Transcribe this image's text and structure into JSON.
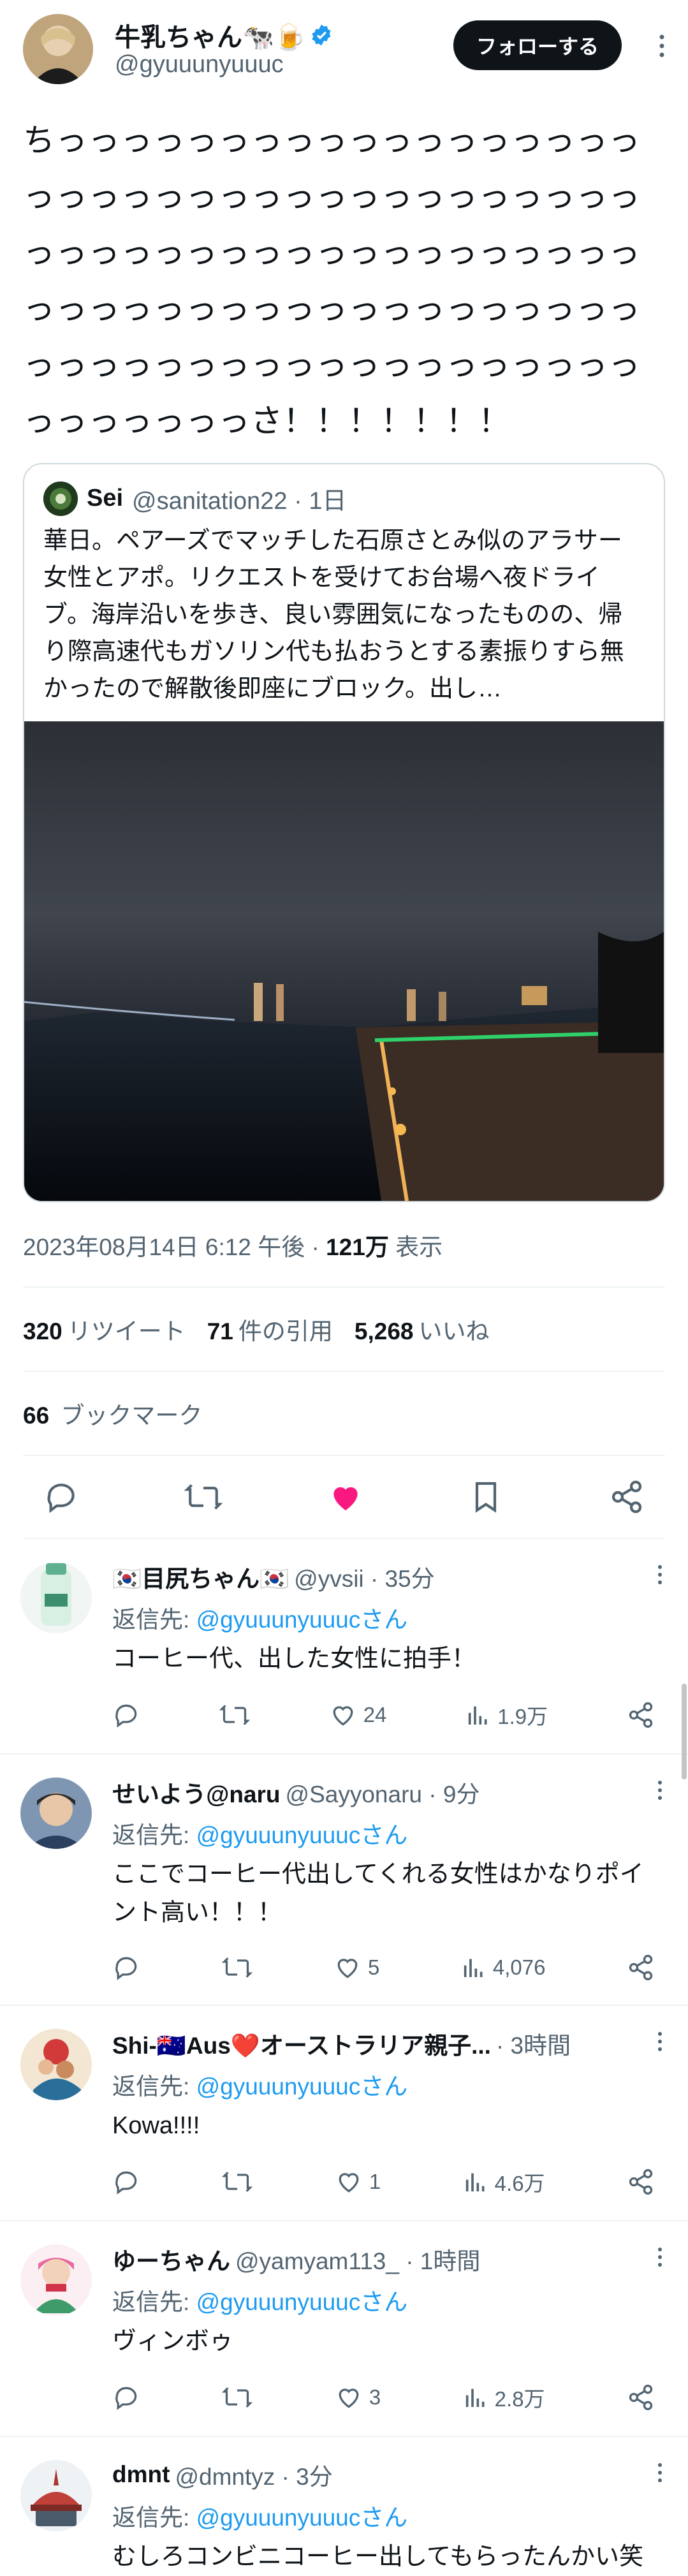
{
  "tweet": {
    "author_name": "牛乳ちゃん🐄🍺",
    "author_handle": "@gyuuunyuuuc",
    "follow_label": "フォローする",
    "text": "ちっっっっっっっっっっっっっっっっっっっっっっっっっっっっっっっっっっっっっっっっっっっっっっっっっっっっっっっっっっっっっっっっっっっっっっっっっっっっっっっっっっっっっっっっっっっっっっっっっっっっっさ！！！！！！！",
    "quote": {
      "name": "Sei",
      "handle_time": "@sanitation22 · 1日",
      "text": "華日。ペアーズでマッチした石原さとみ似のアラサー女性とアポ。リクエストを受けてお台場へ夜ドライブ。海岸沿いを歩き、良い雰囲気になったものの、帰り際高速代もガソリン代も払おうとする素振りすら無かったので解散後即座にブロック。出し…"
    },
    "timestamp": "2023年08月14日 6:12 午後",
    "views_count": "121万",
    "views_label": "表示",
    "retweets_count": "320",
    "retweets_label": "リツイート",
    "quotes_count": "71",
    "quotes_label": "件の引用",
    "likes_count": "5,268",
    "likes_label": "いいね",
    "bookmarks_count": "66",
    "bookmarks_label": "ブックマーク",
    "like_color": "#f91880"
  },
  "replies": [
    {
      "name": "🇰🇷目尻ちゃん🇰🇷",
      "handle_time": "@yvsii · 35分",
      "reply_to_prefix": "返信先: ",
      "reply_to_link": "@gyuuunyuuucさん",
      "text": "コーヒー代、出した女性に拍手！",
      "likes": "24",
      "views": "1.9万"
    },
    {
      "name": "せいよう@naru",
      "handle_time": "@Sayyonaru · 9分",
      "reply_to_prefix": "返信先: ",
      "reply_to_link": "@gyuuunyuuucさん",
      "text": "ここでコーヒー代出してくれる女性はかなりポイント高い！！！",
      "likes": "5",
      "views": "4,076"
    },
    {
      "name": "Shi-🇦🇺Aus❤️オーストラリア親子...",
      "handle_time": "· 3時間",
      "reply_to_prefix": "返信先: ",
      "reply_to_link": "@gyuuunyuuucさん",
      "text": "Kowa!!!!",
      "likes": "1",
      "views": "4.6万"
    },
    {
      "name": "ゆーちゃん",
      "handle_time": "@yamyam113_ · 1時間",
      "reply_to_prefix": "返信先: ",
      "reply_to_link": "@gyuuunyuuucさん",
      "text": "ヴィンボゥ",
      "likes": "3",
      "views": "2.8万"
    },
    {
      "name": "dmnt",
      "handle_time": "@dmntyz · 3分",
      "reply_to_prefix": "返信先: ",
      "reply_to_link": "@gyuuunyuuucさん",
      "text": "むしろコンビニコーヒー出してもらったんかい笑"
    }
  ],
  "icons": {
    "verified": "verified-badge-icon",
    "more": "more-icon",
    "reply": "reply-icon",
    "retweet": "retweet-icon",
    "like": "like-icon",
    "bookmark": "bookmark-icon",
    "share": "share-icon",
    "views": "views-icon"
  },
  "colors": {
    "link": "#1d9bf0",
    "verified": "#1d9bf0",
    "muted": "#536471"
  }
}
